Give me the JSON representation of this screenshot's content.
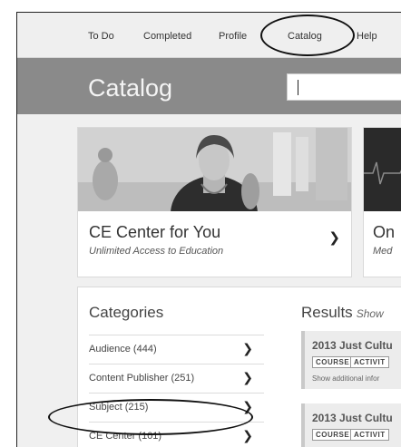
{
  "nav": {
    "items": [
      "To Do",
      "Completed",
      "Profile",
      "Catalog",
      "Help"
    ],
    "active": "Catalog"
  },
  "header": {
    "title": "Catalog",
    "search_value": ""
  },
  "feature_cards": [
    {
      "title": "CE Center for You",
      "subtitle": "Unlimited Access to Education"
    },
    {
      "title": "On",
      "subtitle": "Med"
    }
  ],
  "categories": {
    "title": "Categories",
    "items": [
      {
        "label": "Audience (444)"
      },
      {
        "label": "Content Publisher (251)"
      },
      {
        "label": "Subject (215)"
      },
      {
        "label": "CE Center (101)"
      }
    ]
  },
  "results": {
    "title": "Results",
    "show_label": "Show",
    "items": [
      {
        "title": "2013 Just Cultu",
        "badges": [
          "COURSE",
          "ACTIVIT"
        ],
        "more": "Show additional infor"
      },
      {
        "title": "2013 Just Cultu",
        "badges": [
          "COURSE",
          "ACTIVIT"
        ],
        "more": ""
      }
    ]
  },
  "colors": {
    "header_bg": "#8a8a8a",
    "page_bg": "#f0f0f0",
    "annotation": "#111111"
  }
}
